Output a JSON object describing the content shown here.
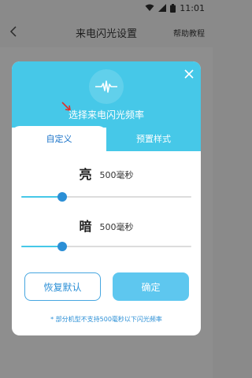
{
  "status_bar": {
    "time": "11:01"
  },
  "header": {
    "title": "来电闪光设置",
    "help": "帮助教程"
  },
  "dialog": {
    "title": "选择来电闪光频率",
    "tabs": [
      {
        "label": "自定义",
        "active": true
      },
      {
        "label": "预置样式",
        "active": false
      }
    ],
    "bright": {
      "label": "亮",
      "value": "500毫秒",
      "position_fraction": 0.24
    },
    "dark": {
      "label": "暗",
      "value": "500毫秒",
      "position_fraction": 0.24
    },
    "buttons": {
      "reset": "恢复默认",
      "confirm": "确定"
    },
    "note": "* 部分机型不支持500毫秒以下闪光频率"
  },
  "colors": {
    "accent": "#46c8e8",
    "primary": "#2b8fd6",
    "button": "#5ec7ef"
  },
  "icons": [
    "back-arrow-icon",
    "waveform-icon",
    "close-icon",
    "wifi-icon",
    "signal-icon",
    "battery-icon"
  ]
}
